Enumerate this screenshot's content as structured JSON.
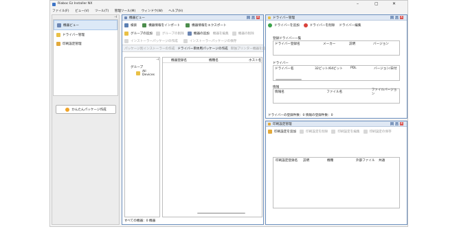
{
  "app": {
    "title": "Riaboc Ez Installer NX",
    "controls": [
      "–",
      "▢",
      "✕"
    ]
  },
  "menu": [
    "ファイル(F)",
    "ビュー(V)",
    "ツール(T)",
    "管理ツール(M)",
    "ウィンドウ(W)",
    "ヘルプ(H)"
  ],
  "nav": {
    "items": [
      {
        "label": "機器ビュー",
        "icon": "devices-icon",
        "selected": true
      },
      {
        "label": "ドライバー管理",
        "icon": "driver-folder-icon",
        "selected": false
      },
      {
        "label": "印刷設定管理",
        "icon": "print-settings-icon",
        "selected": false
      }
    ],
    "package_button": "かんたんパッケージ作成"
  },
  "device_view": {
    "title": "機器ビュー",
    "toolbar1": [
      "検索",
      "機器情報をインポート",
      "機器情報をエクスポート"
    ],
    "toolbar2": [
      {
        "label": "グループの追加",
        "enabled": true
      },
      {
        "label": "グループの削除",
        "enabled": false
      },
      {
        "label": "機器の追加",
        "enabled": true
      },
      {
        "label": "機器を編集",
        "enabled": false
      },
      {
        "label": "機器の削除",
        "enabled": false
      }
    ],
    "toolbar3": [
      "インストーラーパッケージの作成",
      "インストーラーパッケージの保存"
    ],
    "tabs": [
      "パッケージ別インストーラーの作成",
      "ドライバー単体用パッケージの作成",
      "単独プリンター機器を追加"
    ],
    "tree_header": "グループ",
    "tree_item": "All Devices",
    "columns": [
      "機器登録名",
      "機種名",
      "ホスト名"
    ],
    "status": "すべての機器：0 機器"
  },
  "driver_mgmt": {
    "title": "ドライバー管理",
    "buttons": [
      "ドライバーを追加",
      "ドライバーを削除",
      "ドライバー編集"
    ],
    "registered": {
      "title": "登録ドライバー一覧",
      "columns": [
        "ドライバー登録名",
        "メーカー",
        "説明",
        "バージョン"
      ]
    },
    "driver": {
      "title": "ドライバー",
      "columns": [
        "ドライバー名",
        "32ビット/64ビット",
        "PDL",
        "バージョン/日付"
      ]
    },
    "info": {
      "title": "情報",
      "columns": [
        "情報名",
        "ファイル名",
        "ファイルバージョン"
      ]
    },
    "status": "ドライバーの登録件数：0  情報の登録件数：0"
  },
  "print_mgmt": {
    "title": "印刷設定管理",
    "toolbar": [
      {
        "label": "印刷設定を追加",
        "enabled": true
      },
      {
        "label": "印刷設定を削除",
        "enabled": false
      },
      {
        "label": "印刷設定を編集",
        "enabled": false
      },
      {
        "label": "印刷設定の保存",
        "enabled": false
      }
    ],
    "columns": [
      "印刷設定登録名",
      "説明",
      "機種",
      "外部ファイル",
      "共通"
    ]
  },
  "colors": {
    "accent": "#6b8fbe",
    "panel_title": "#dfe8f4",
    "selected": "#dce9f7",
    "close": "#d9534f"
  }
}
